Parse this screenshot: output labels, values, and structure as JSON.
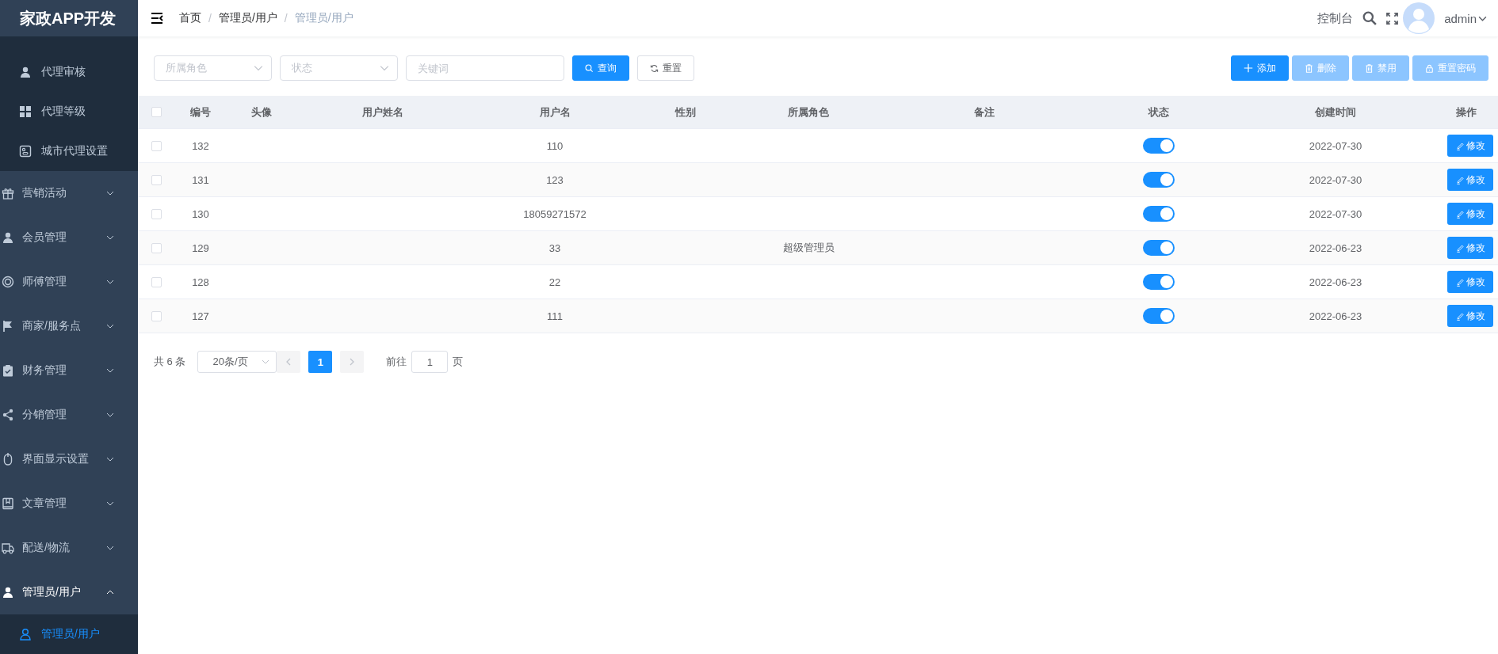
{
  "app_title": "家政APP开发",
  "sidebar": {
    "items": [
      {
        "kind": "link",
        "label": "代理审核",
        "selected": false
      },
      {
        "kind": "link",
        "label": "代理等级",
        "selected": false
      },
      {
        "kind": "link",
        "label": "城市代理设置",
        "selected": false
      },
      {
        "kind": "group",
        "label": "营销活动",
        "expanded": false
      },
      {
        "kind": "group",
        "label": "会员管理",
        "expanded": false
      },
      {
        "kind": "group",
        "label": "师傅管理",
        "expanded": false
      },
      {
        "kind": "group",
        "label": "商家/服务点",
        "expanded": false
      },
      {
        "kind": "group",
        "label": "财务管理",
        "expanded": false
      },
      {
        "kind": "group",
        "label": "分销管理",
        "expanded": false
      },
      {
        "kind": "group",
        "label": "界面显示设置",
        "expanded": false
      },
      {
        "kind": "group",
        "label": "文章管理",
        "expanded": false
      },
      {
        "kind": "group",
        "label": "配送/物流",
        "expanded": false
      },
      {
        "kind": "group",
        "label": "管理员/用户",
        "expanded": true,
        "children": [
          {
            "kind": "link",
            "label": "管理员/用户",
            "selected": true
          }
        ]
      }
    ]
  },
  "header": {
    "breadcrumb": [
      "首页",
      "管理员/用户",
      "管理员/用户"
    ],
    "breadcrumb_separators": [
      "/",
      "/"
    ],
    "console_link": "控制台",
    "user_name": "admin"
  },
  "filters": {
    "role_select": {
      "placeholder": "所属角色"
    },
    "status_select": {
      "placeholder": "状态"
    },
    "keyword_field": {
      "placeholder": "关键词"
    },
    "search_button": "查询",
    "reset_button": "重置"
  },
  "toolbar": {
    "actions": [
      {
        "label": "添加",
        "disabled": false
      },
      {
        "label": "删除",
        "disabled": true
      },
      {
        "label": "禁用",
        "disabled": true
      },
      {
        "label": "重置密码",
        "disabled": true
      }
    ]
  },
  "table": {
    "all_selected": false,
    "columns": [
      "编号",
      "头像",
      "用户姓名",
      "用户名",
      "性别",
      "所属角色",
      "备注",
      "状态",
      "创建时间",
      "操作"
    ],
    "rows": [
      {
        "selected": false,
        "id": "132",
        "username": "110",
        "enabled": true,
        "created_at": "2022-07-30",
        "edit_label": "修改"
      },
      {
        "selected": false,
        "id": "131",
        "username": "123",
        "enabled": true,
        "created_at": "2022-07-30",
        "edit_label": "修改"
      },
      {
        "selected": false,
        "id": "130",
        "username": "18059271572",
        "enabled": true,
        "created_at": "2022-07-30",
        "edit_label": "修改"
      },
      {
        "selected": false,
        "id": "129",
        "username": "33",
        "role": "超级管理员",
        "enabled": true,
        "created_at": "2022-06-23",
        "edit_label": "修改"
      },
      {
        "selected": false,
        "id": "128",
        "username": "22",
        "enabled": true,
        "created_at": "2022-06-23",
        "edit_label": "修改"
      },
      {
        "selected": false,
        "id": "127",
        "username": "111",
        "enabled": true,
        "created_at": "2022-06-23",
        "edit_label": "修改"
      }
    ]
  },
  "pagination": {
    "total": "共 6 条",
    "page_size": "20条/页",
    "pages": [
      {
        "label": "1",
        "selected": true
      }
    ],
    "goto_label": "前往",
    "goto_value": "1",
    "page_suffix": "页"
  }
}
